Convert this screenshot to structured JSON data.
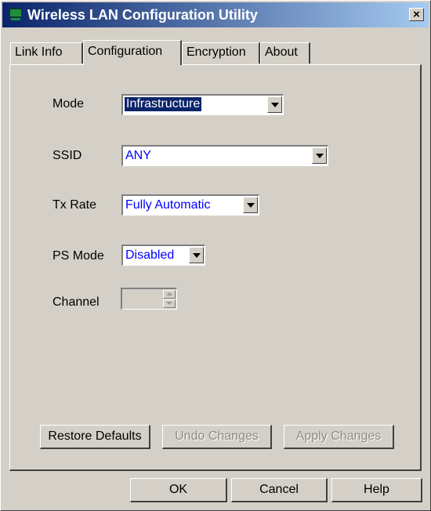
{
  "window": {
    "title": "Wireless LAN Configuration Utility",
    "close_label": "×"
  },
  "tabs": [
    {
      "label": "Link Info"
    },
    {
      "label": "Configuration"
    },
    {
      "label": "Encryption"
    },
    {
      "label": "About"
    }
  ],
  "config": {
    "mode": {
      "label": "Mode",
      "value": "Infrastructure"
    },
    "ssid": {
      "label": "SSID",
      "value": "ANY"
    },
    "tx_rate": {
      "label": "Tx Rate",
      "value": "Fully Automatic"
    },
    "ps_mode": {
      "label": "PS Mode",
      "value": "Disabled"
    },
    "channel": {
      "label": "Channel",
      "value": ""
    }
  },
  "panel_buttons": {
    "restore": "Restore Defaults",
    "undo": "Undo Changes",
    "apply": "Apply Changes"
  },
  "dialog_buttons": {
    "ok": "OK",
    "cancel": "Cancel",
    "help": "Help"
  }
}
